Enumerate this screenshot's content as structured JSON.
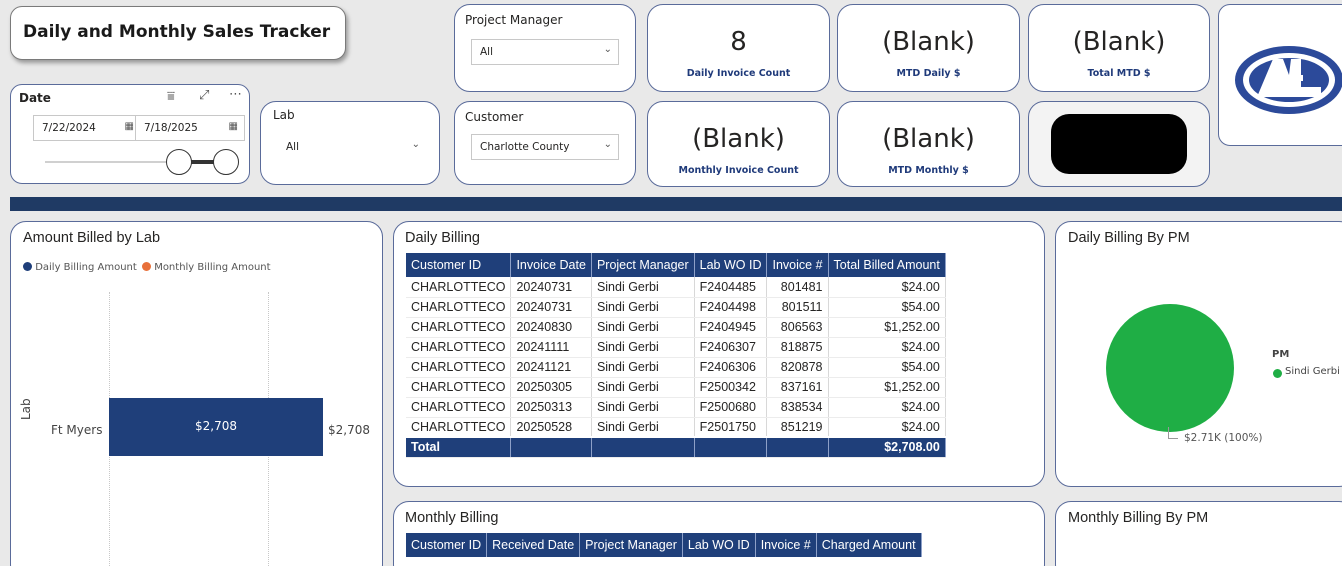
{
  "header": {
    "title": "Daily and Monthly Sales Tracker"
  },
  "date_slicer": {
    "label": "Date",
    "start": "7/22/2024",
    "end": "7/18/2025"
  },
  "lab_slicer": {
    "label": "Lab",
    "value": "All"
  },
  "pm_slicer": {
    "label": "Project Manager",
    "value": "All"
  },
  "customer_slicer": {
    "label": "Customer",
    "value": "Charlotte County"
  },
  "kpis": {
    "daily_invoice_count": {
      "value": "8",
      "label": "Daily Invoice Count"
    },
    "mtd_daily": {
      "value": "(Blank)",
      "label": "MTD Daily $"
    },
    "total_mtd": {
      "value": "(Blank)",
      "label": "Total MTD $"
    },
    "monthly_invoice_count": {
      "value": "(Blank)",
      "label": "Monthly Invoice Count"
    },
    "mtd_monthly": {
      "value": "(Blank)",
      "label": "MTD Monthly $"
    }
  },
  "colors": {
    "navy": "#1f3f7a",
    "orange": "#e8703a",
    "green": "#1fae45",
    "banner": "#1f3a64"
  },
  "icons": {
    "filter": "filter-icon",
    "focus": "focus-mode-icon",
    "more": "more-options-icon",
    "calendar": "calendar-icon",
    "chevron": "chevron-down-icon"
  },
  "amount_billed": {
    "title": "Amount Billed by Lab",
    "legend": [
      "Daily Billing Amount",
      "Monthly Billing Amount"
    ],
    "ylabel": "Lab",
    "category": "Ft Myers",
    "bar_label": "$2,708",
    "end_label": "$2,708"
  },
  "chart_data": [
    {
      "type": "bar",
      "title": "Amount Billed by Lab",
      "ylabel": "Lab",
      "categories": [
        "Ft Myers"
      ],
      "series": [
        {
          "name": "Daily Billing Amount",
          "values": [
            2708
          ]
        },
        {
          "name": "Monthly Billing Amount",
          "values": [
            0
          ]
        }
      ]
    },
    {
      "type": "pie",
      "title": "Daily Billing By PM",
      "categories": [
        "Sindi Gerbi"
      ],
      "values": [
        2708
      ],
      "legend_title": "PM",
      "data_labels": [
        "$2.71K (100%)"
      ]
    }
  ],
  "daily_billing": {
    "title": "Daily Billing",
    "columns": [
      "Customer ID",
      "Invoice Date",
      "Project Manager",
      "Lab WO ID",
      "Invoice #",
      "Total Billed Amount"
    ],
    "rows": [
      [
        "CHARLOTTECO",
        "20240731",
        "Sindi Gerbi",
        "F2404485",
        "801481",
        "$24.00"
      ],
      [
        "CHARLOTTECO",
        "20240731",
        "Sindi Gerbi",
        "F2404498",
        "801511",
        "$54.00"
      ],
      [
        "CHARLOTTECO",
        "20240830",
        "Sindi Gerbi",
        "F2404945",
        "806563",
        "$1,252.00"
      ],
      [
        "CHARLOTTECO",
        "20241111",
        "Sindi Gerbi",
        "F2406307",
        "818875",
        "$24.00"
      ],
      [
        "CHARLOTTECO",
        "20241121",
        "Sindi Gerbi",
        "F2406306",
        "820878",
        "$54.00"
      ],
      [
        "CHARLOTTECO",
        "20250305",
        "Sindi Gerbi",
        "F2500342",
        "837161",
        "$1,252.00"
      ],
      [
        "CHARLOTTECO",
        "20250313",
        "Sindi Gerbi",
        "F2500680",
        "838534",
        "$24.00"
      ],
      [
        "CHARLOTTECO",
        "20250528",
        "Sindi Gerbi",
        "F2501750",
        "851219",
        "$24.00"
      ]
    ],
    "total_label": "Total",
    "total_value": "$2,708.00"
  },
  "pie": {
    "title": "Daily Billing By PM",
    "legend_title": "PM",
    "legend_item": "Sindi Gerbi",
    "data_label": "$2.71K (100%)"
  },
  "monthly_billing": {
    "title": "Monthly Billing",
    "columns": [
      "Customer ID",
      "Received Date",
      "Project Manager",
      "Lab WO ID",
      "Invoice #",
      "Charged Amount"
    ]
  },
  "monthly_pm": {
    "title": "Monthly Billing By PM"
  }
}
